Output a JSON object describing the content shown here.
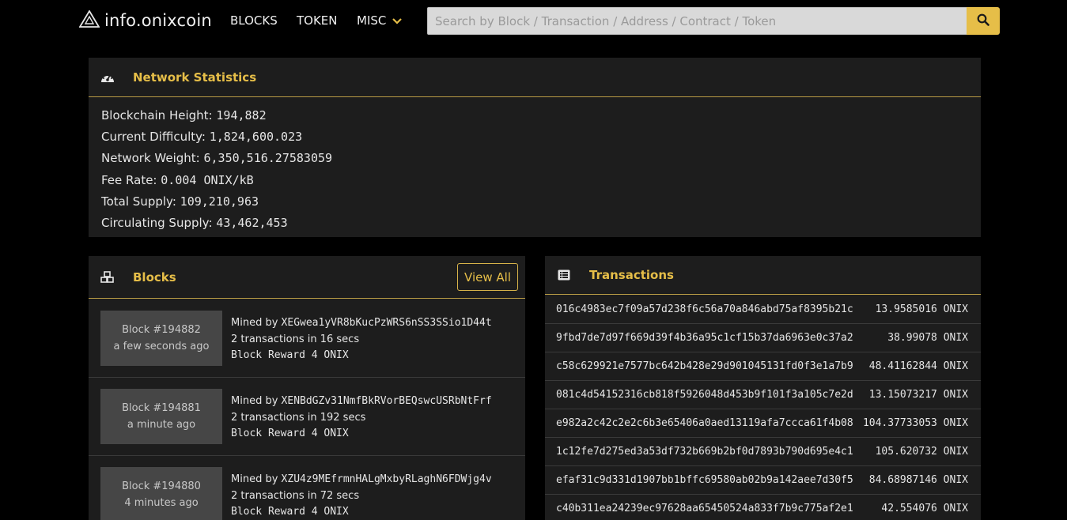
{
  "nav": {
    "brand": "info.onixcoin",
    "links": [
      "BLOCKS",
      "TOKEN",
      "MISC"
    ],
    "search_placeholder": "Search by Block / Transaction / Address / Contract / Token"
  },
  "colors": {
    "accent": "#e6be48",
    "card_bg": "#1d1d1d",
    "page_bg": "#000000",
    "block_box": "#464646"
  },
  "icons": {
    "brand": "onix-triangle-logo",
    "search": "search-icon",
    "stats": "speedometer-icon",
    "blocks": "cubes-icon",
    "txs": "list-icon",
    "dropdown": "chevron-down-icon"
  },
  "stats": {
    "title": "Network Statistics",
    "rows": [
      {
        "label": "Blockchain Height:",
        "value": "194,882"
      },
      {
        "label": "Current Difficulty:",
        "value": "1,824,600.023"
      },
      {
        "label": "Network Weight:",
        "value": "6,350,516.27583059"
      },
      {
        "label": "Fee Rate:",
        "value": "0.004 ONIX/kB"
      },
      {
        "label": "Total Supply:",
        "value": "109,210,963"
      },
      {
        "label": "Circulating Supply:",
        "value": "43,462,453"
      }
    ]
  },
  "blocks": {
    "title": "Blocks",
    "view_all": "View All",
    "mined_by_label": "Mined by",
    "items": [
      {
        "block": "Block #194882",
        "ago": "a few seconds ago",
        "miner": "XEGwea1yVR8bKucPzWRS6nSS3SSio1D44t",
        "txinfo": "2 transactions in 16 secs",
        "reward": "Block Reward 4 ONIX"
      },
      {
        "block": "Block #194881",
        "ago": "a minute ago",
        "miner": "XENBdGZv31NmfBkRVorBEQswcUSRbNtFrf",
        "txinfo": "2 transactions in 192 secs",
        "reward": "Block Reward 4 ONIX"
      },
      {
        "block": "Block #194880",
        "ago": "4 minutes ago",
        "miner": "XZU4z9MEfrmnHALgMxbyRLaghN6FDWjg4v",
        "txinfo": "2 transactions in 72 secs",
        "reward": "Block Reward 4 ONIX"
      }
    ]
  },
  "transactions": {
    "title": "Transactions",
    "items": [
      {
        "hash": "016c4983ec7f09a57d238f6c56a70a846abd75af8395b21c",
        "amount": "13.9585016 ONIX"
      },
      {
        "hash": "9fbd7de7d97f669d39f4b36a95c1cf15b37da6963e0c37a2",
        "amount": "38.99078 ONIX"
      },
      {
        "hash": "c58c629921e7577bc642b428e29d901045131fd0f3e1a7b9",
        "amount": "48.41162844 ONIX"
      },
      {
        "hash": "081c4d54152316cb818f5926048d453b9f101f3a105c7e2d",
        "amount": "13.15073217 ONIX"
      },
      {
        "hash": "e982a2c42c2e2c6b3e65406a0aed13119afa7ccca61f4b08",
        "amount": "104.37733053 ONIX"
      },
      {
        "hash": "1c12fe7d275ed3a53df732b669b2bf0d7893b790d695e4c1",
        "amount": "105.620732 ONIX"
      },
      {
        "hash": "efaf31c9d331d1907bb1bffc69580ab02b9a142aee7d30f5",
        "amount": "84.68987146 ONIX"
      },
      {
        "hash": "c40b311ea24239ec97628aa65450524a833f7b9c775af2e1",
        "amount": "42.554076 ONIX"
      }
    ]
  }
}
